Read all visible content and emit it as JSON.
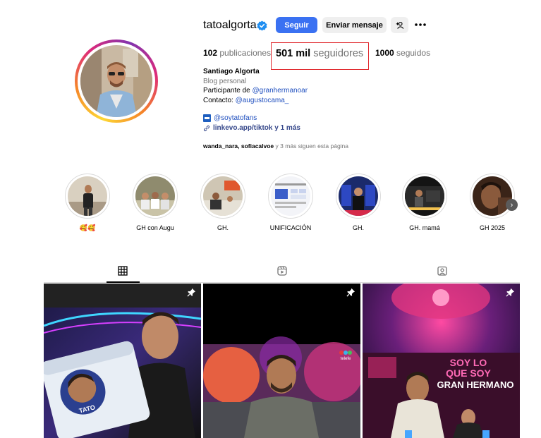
{
  "profile": {
    "username": "tatoalgorta",
    "follow_label": "Seguir",
    "message_label": "Enviar mensaje"
  },
  "stats": {
    "posts_count": "102",
    "posts_label": "publicaciones",
    "followers_count": "501 mil",
    "followers_label": "seguidores",
    "following_count": "1000",
    "following_label": "seguidos"
  },
  "bio": {
    "name": "Santiago Algorta",
    "category": "Blog personal",
    "participant_prefix": "Participante de ",
    "participant_handle": "@granhermanoar",
    "contact_prefix": "Contacto: ",
    "contact_handle": "@augustocama_",
    "fan_handle": "@soytatofans",
    "link": "linkevo.app/tiktok y 1 más",
    "followed_by_names": "wanda_nara, sofiacalvoe",
    "followed_by_rest": " y 3 más siguen esta página"
  },
  "highlights": [
    {
      "label": "🥰🥰"
    },
    {
      "label": "GH con Augu"
    },
    {
      "label": "GH."
    },
    {
      "label": "UNIFICACIÓN"
    },
    {
      "label": "GH."
    },
    {
      "label": "GH. mamá"
    },
    {
      "label": "GH 2025"
    }
  ],
  "posts": {
    "post1_caption": "TATO",
    "post2_caption": "telefe",
    "post3_caption_line1": "SOY LO",
    "post3_caption_line2": "QUE SOY",
    "post3_caption_line3": "GRAN HERMANO"
  },
  "icons": {
    "verified": "verified-badge-icon",
    "add_person": "add-person-icon",
    "more": "more-options-icon",
    "grid": "grid-icon",
    "reels": "reels-icon",
    "tagged": "tagged-icon",
    "pin": "pin-icon",
    "facebook": "facebook-icon",
    "link": "link-icon"
  },
  "colors": {
    "follow_button": "#3a71f2",
    "highlight_box": "#e0262b",
    "link": "#35478a"
  }
}
